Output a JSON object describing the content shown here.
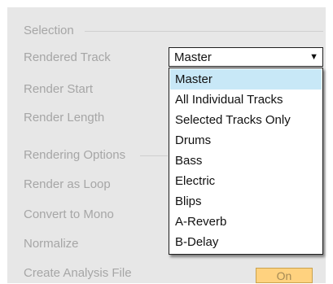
{
  "sections": {
    "selection": "Selection",
    "rendering_options": "Rendering Options"
  },
  "labels": {
    "rendered_track": "Rendered Track",
    "render_start": "Render Start",
    "render_length": "Render Length",
    "render_as_loop": "Render as Loop",
    "convert_to_mono": "Convert to Mono",
    "normalize": "Normalize",
    "create_analysis_file": "Create Analysis File"
  },
  "rendered_track_select": {
    "value": "Master",
    "arrow_icon": "triangle-down-icon"
  },
  "dropdown": {
    "selected_index": 0,
    "options": [
      "Master",
      "All Individual Tracks",
      "Selected Tracks Only",
      "Drums",
      "Bass",
      "Electric",
      "Blips",
      "A-Reverb",
      "B-Delay"
    ]
  },
  "create_analysis_toggle": {
    "value": "On",
    "color": "#ffd27f"
  },
  "colors": {
    "panel_bg": "#e7e7e7",
    "label_text": "#a6a6a6",
    "highlight": "#c8e8f7"
  }
}
